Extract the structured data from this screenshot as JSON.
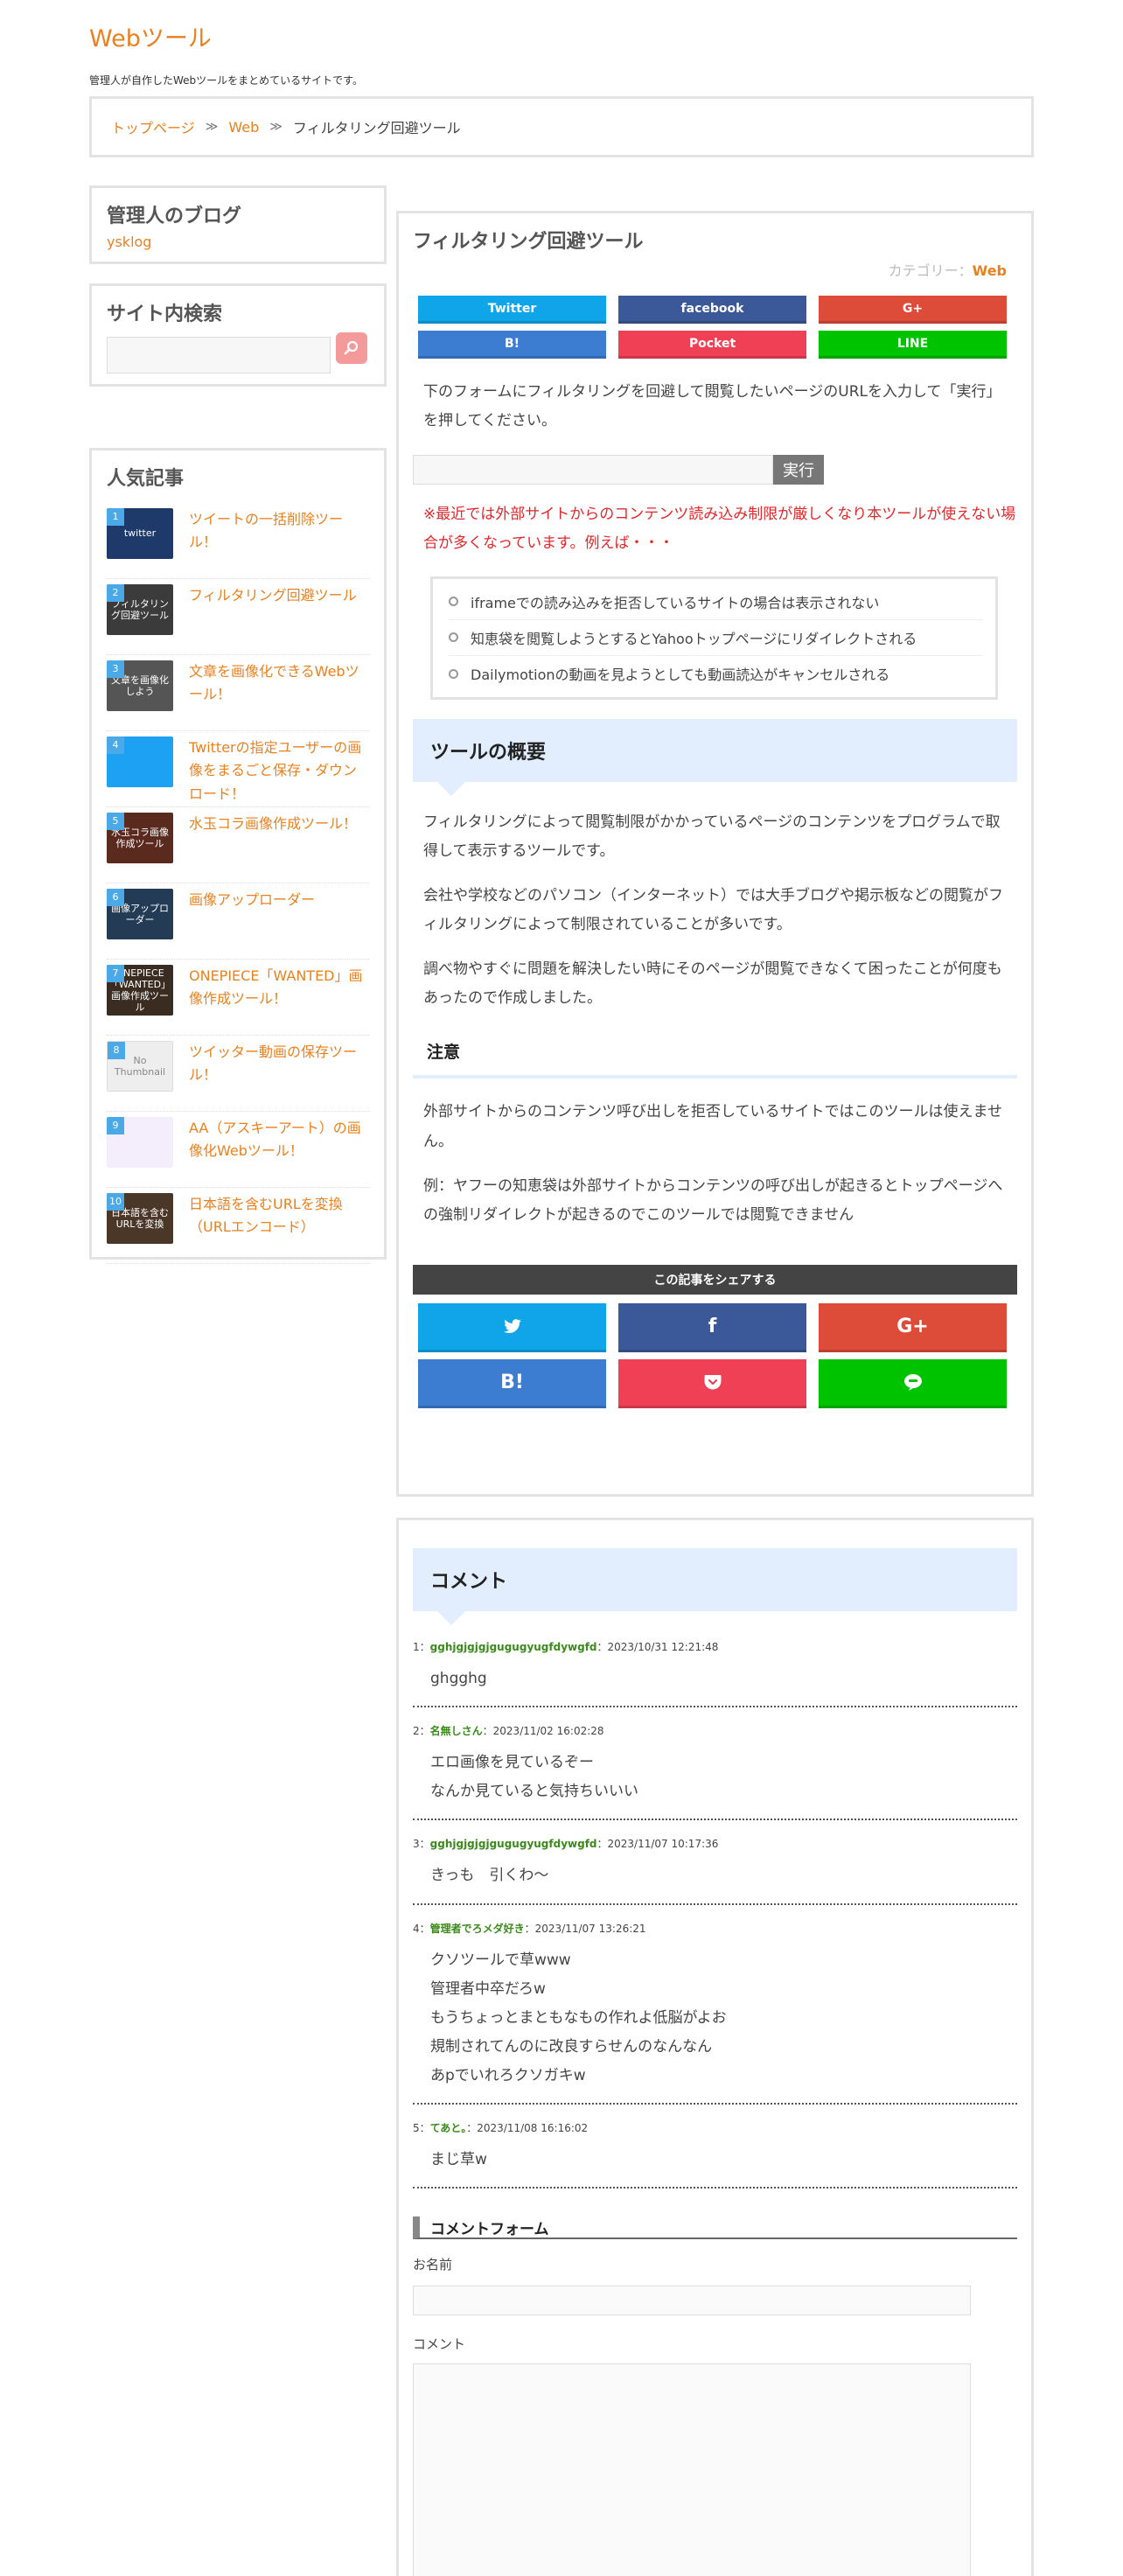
{
  "site": {
    "title": "Webツール",
    "description": "管理人が自作したWebツールをまとめているサイトです。"
  },
  "breadcrumb": {
    "home": "トップページ",
    "category": "Web",
    "current": "フィルタリング回避ツール",
    "separator": "≫"
  },
  "sidebar": {
    "blog": {
      "title": "管理人のブログ",
      "link": "ysklog"
    },
    "search": {
      "title": "サイト内検索",
      "placeholder": "",
      "button_icon": "search-icon"
    },
    "popular": {
      "title": "人気記事",
      "items": [
        {
          "rank": "1",
          "title": "ツイートの一括削除ツール！",
          "thumb_text": "twitter",
          "thumb_color": "#1d3a6a"
        },
        {
          "rank": "2",
          "title": "フィルタリング回避ツール",
          "thumb_text": "フィルタリング回避ツール",
          "thumb_color": "#3b3b3b"
        },
        {
          "rank": "3",
          "title": "文章を画像化できるWebツール！",
          "thumb_text": "文章を画像化しよう",
          "thumb_color": "#555555"
        },
        {
          "rank": "4",
          "title": "Twitterの指定ユーザーの画像をまるごと保存・ダウンロード！",
          "thumb_text": "",
          "thumb_color": "#1da1f2"
        },
        {
          "rank": "5",
          "title": "水玉コラ画像作成ツール！",
          "thumb_text": "水玉コラ画像作成ツール",
          "thumb_color": "#5a2a1e"
        },
        {
          "rank": "6",
          "title": "画像アップローダー",
          "thumb_text": "画像アップローダー",
          "thumb_color": "#233b55"
        },
        {
          "rank": "7",
          "title": "ONEPIECE「WANTED」画像作成ツール！",
          "thumb_text": "ONEPIECE「WANTED」画像作成ツール",
          "thumb_color": "#3a2c20"
        },
        {
          "rank": "8",
          "title": "ツイッター動画の保存ツール！",
          "thumb_text": "No Thumbnail",
          "thumb_color": "#eeeeee"
        },
        {
          "rank": "9",
          "title": "AA（アスキーアート）の画像化Webツール！",
          "thumb_text": "",
          "thumb_color": "#f4eefc"
        },
        {
          "rank": "10",
          "title": "日本語を含むURLを変換（URLエンコード）",
          "thumb_text": "日本語を含むURLを変換",
          "thumb_color": "#4a3728"
        }
      ]
    }
  },
  "article": {
    "title": "フィルタリング回避ツール",
    "category_label": "カテゴリー：",
    "category": "Web",
    "share_top": [
      "Twitter",
      "facebook",
      "G+",
      "B!",
      "Pocket",
      "LINE"
    ],
    "intro": "下のフォームにフィルタリングを回避して閲覧したいページのURLを入力して「実行」を押してください。",
    "url_input_value": "",
    "exec_button": "実行",
    "warning": "※最近では外部サイトからのコンテンツ読み込み制限が厳しくなり本ツールが使えない場合が多くなっています。例えば・・・",
    "examples": [
      "iframeでの読み込みを拒否しているサイトの場合は表示されない",
      "知恵袋を閲覧しようとするとYahooトップページにリダイレクトされる",
      "Dailymotionの動画を見ようとしても動画読込がキャンセルされる"
    ],
    "overview_heading": "ツールの概要",
    "overview_paras": [
      "フィルタリングによって閲覧制限がかかっているページのコンテンツをプログラムで取得して表示するツールです。",
      "会社や学校などのパソコン（インターネット）では大手ブログや掲示板などの閲覧がフィルタリングによって制限されていることが多いです。",
      "調べ物やすぐに問題を解決したい時にそのページが閲覧できなくて困ったことが何度もあったので作成しました。"
    ],
    "note_heading": "注意",
    "note_paras": [
      "外部サイトからのコンテンツ呼び出しを拒否しているサイトではこのツールは使えません。",
      "例：ヤフーの知恵袋は外部サイトからコンテンツの呼び出しが起きるとトップページへの強制リダイレクトが起きるのでこのツールでは閲覧できません"
    ],
    "share_bar": "この記事をシェアする",
    "share_bottom_icons": [
      "twitter-icon",
      "facebook-icon",
      "google-plus-icon",
      "hatena-bookmark-icon",
      "pocket-icon",
      "line-icon"
    ],
    "share_bottom_labels": [
      "",
      "f",
      "G+",
      "B!",
      "",
      ""
    ]
  },
  "comments": {
    "heading": "コメント",
    "items": [
      {
        "num": "1：",
        "name": "gghjgjgjgjgugugyugfdywgfd",
        "date": "：2023/10/31 12:21:48",
        "lines": [
          "ghgghg"
        ]
      },
      {
        "num": "2：",
        "name": "名無しさん",
        "date": "：2023/11/02 16:02:28",
        "lines": [
          "エロ画像を見ているぞー",
          "なんか見ていると気持ちいいい"
        ]
      },
      {
        "num": "3：",
        "name": "gghjgjgjgjgugugyugfdywgfd",
        "date": "：2023/11/07 10:17:36",
        "lines": [
          "きっも　引くわ〜"
        ]
      },
      {
        "num": "4：",
        "name": "管理者でろメダ好き",
        "date": "：2023/11/07 13:26:21",
        "lines": [
          "クソツールで草www",
          "管理者中卒だろw",
          "もうちょっとまともなもの作れよ低脳がよお",
          "規制されてんのに改良すらせんのなんなん",
          "あpでいれろクソガキw"
        ]
      },
      {
        "num": "5：",
        "name": "てあと。",
        "date": "：2023/11/08 16:16:02",
        "lines": [
          "まじ草w"
        ]
      }
    ],
    "form": {
      "title": "コメントフォーム",
      "name_label": "お名前",
      "comment_label": "コメント"
    }
  }
}
